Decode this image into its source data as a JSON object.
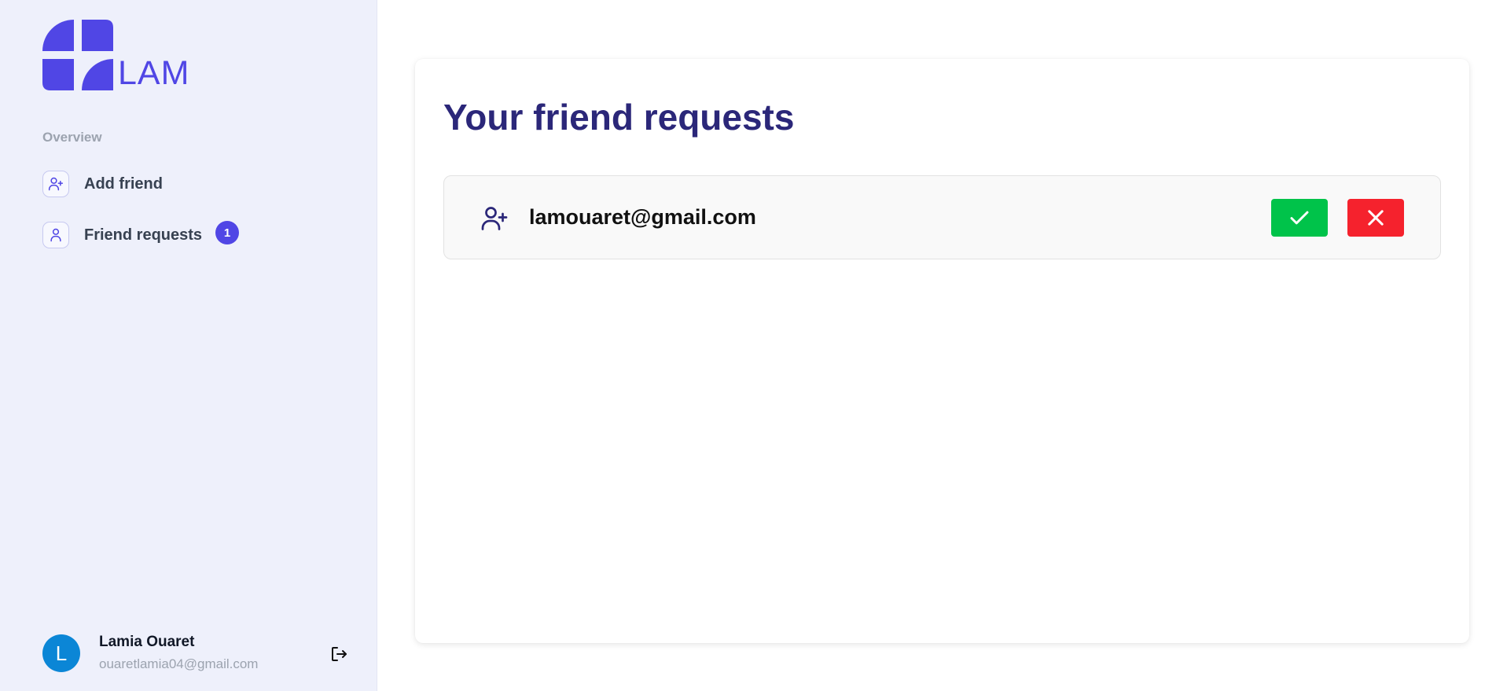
{
  "brand": {
    "name": "LAM",
    "color": "#5046e5"
  },
  "sidebar": {
    "section_label": "Overview",
    "items": [
      {
        "label": "Add friend",
        "icon": "user-plus-icon"
      },
      {
        "label": "Friend requests",
        "icon": "user-icon",
        "badge": "1"
      }
    ]
  },
  "user": {
    "initial": "L",
    "name": "Lamia Ouaret",
    "email": "ouaretlamia04@gmail.com",
    "logout_icon": "sign-out-icon"
  },
  "main": {
    "title": "Your friend requests",
    "requests": [
      {
        "email": "lamouaret@gmail.com",
        "icon": "user-plus-icon",
        "accept_icon": "check-icon",
        "deny_icon": "x-icon"
      }
    ]
  },
  "colors": {
    "accent": "#5046e5",
    "title": "#2b2779",
    "accept": "#00c34a",
    "deny": "#f5222d",
    "sidebar_bg": "#eef0fb",
    "avatar": "#0b86d6"
  }
}
